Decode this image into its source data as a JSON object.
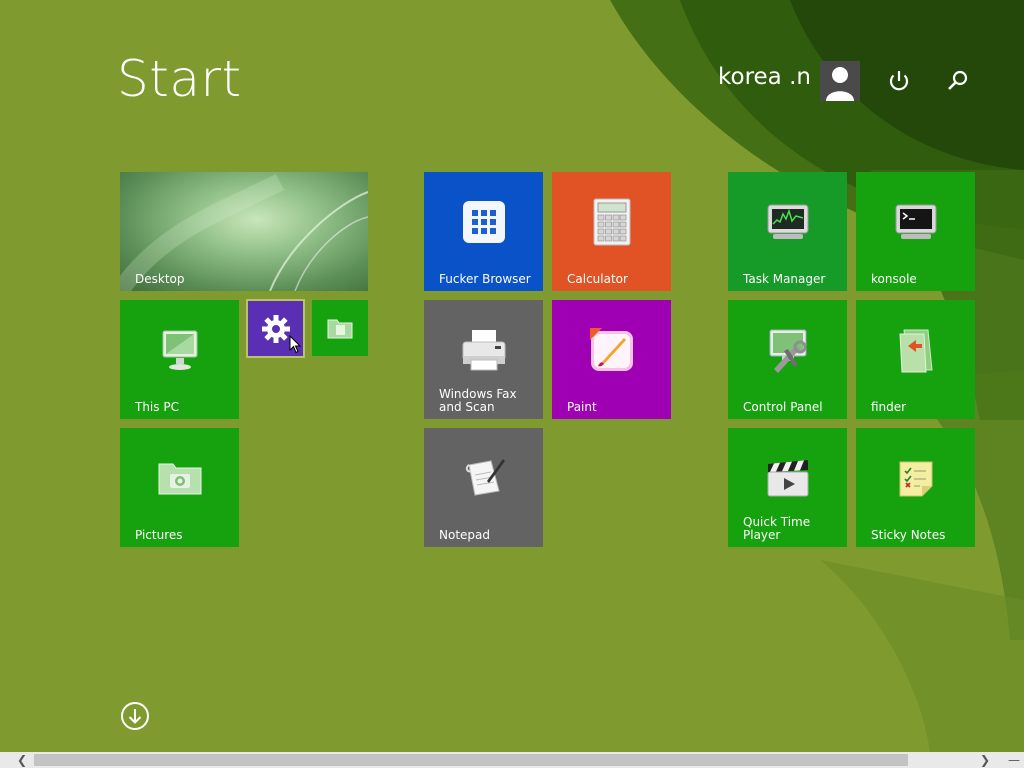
{
  "header": {
    "title": "Start",
    "user_name": "korea .n",
    "avatar_icon": "user-avatar-icon",
    "power_icon": "power-icon",
    "search_icon": "search-icon"
  },
  "tiles": {
    "desktop": "Desktop",
    "this_pc": "This PC",
    "pictures": "Pictures",
    "settings_icon": "gear-icon",
    "small_folder_icon": "folder-icon",
    "browser": "Fucker Browser",
    "calculator": "Calculator",
    "fax_line1": "Windows Fax",
    "fax_line2": "and Scan",
    "paint": "Paint",
    "notepad": "Notepad",
    "task_manager": "Task Manager",
    "konsole": "konsole",
    "control_panel": "Control Panel",
    "finder": "finder",
    "quicktime_line1": "Quick Time",
    "quicktime_line2": "Player",
    "sticky_notes": "Sticky Notes"
  },
  "colors": {
    "background": "#7f9a2f",
    "tile_green": "#16a20f",
    "tile_blue": "#0a52c8",
    "tile_orange": "#e15224",
    "tile_purple": "#5b2fb3",
    "tile_magenta": "#a000b4",
    "tile_gray": "#636363"
  }
}
